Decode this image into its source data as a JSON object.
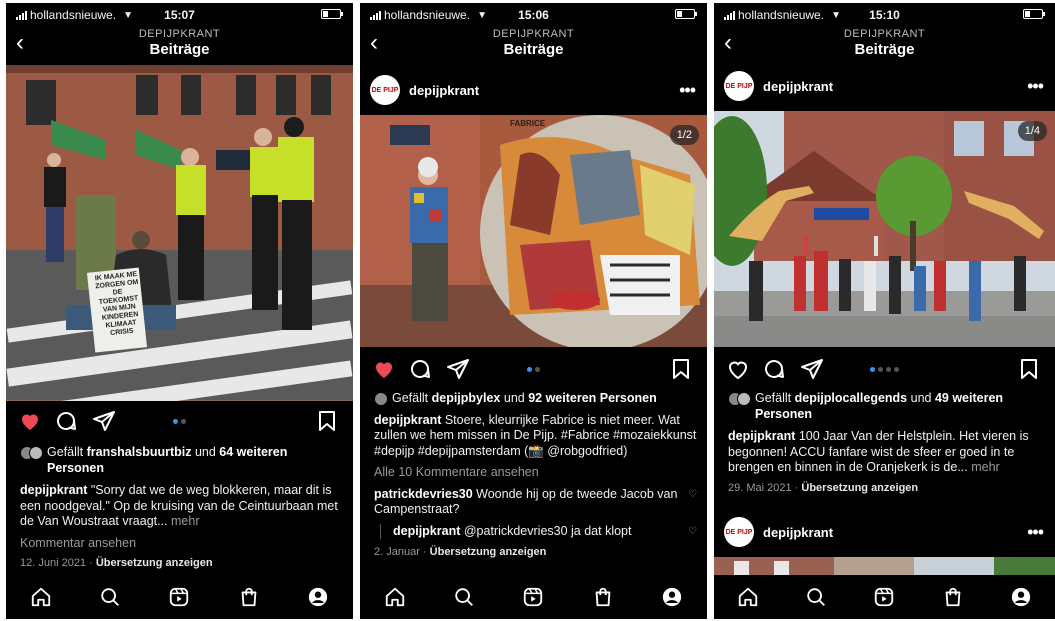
{
  "colors": {
    "background": "#000000",
    "like_red": "#ed4956",
    "dot_blue": "#3897f0",
    "muted": "#9a9a9a"
  },
  "icons": {
    "back": "chevron-left-icon",
    "more": "ellipsis-icon",
    "like": "heart-icon",
    "comment": "comment-bubble-icon",
    "share": "paper-plane-icon",
    "save": "bookmark-icon",
    "home": "home-icon",
    "search": "search-icon",
    "reels": "reels-icon",
    "shop": "shopping-bag-icon",
    "profile": "profile-icon"
  },
  "phones": [
    {
      "status": {
        "carrier": "hollandsnieuwe.",
        "time": "15:07"
      },
      "header": {
        "account": "DEPIJPKRANT",
        "title": "Beiträge"
      },
      "post": {
        "liked": true,
        "likes_prefix": "Gefällt ",
        "likes_user": "franshalsbuurtbiz",
        "likes_mid": " und ",
        "likes_others": "64 weiteren Personen",
        "caption_user": "depijpkrant",
        "caption_text": " \"Sorry dat we de weg blokkeren, maar dit is een noodgeval.\" Op de kruising van de Ceintuurbaan met de Van Woustraat vraagt...",
        "caption_more": " mehr",
        "view_comments": "Kommentar ansehen",
        "date": "12. Juni 2021",
        "sep": " · ",
        "translate": "Übersetzung anzeigen",
        "sign_text": "IK MAAK ME ZORGEN OM DE TOEKOMST VAN MIJN KINDEREN KLIMAAT CRISIS"
      }
    },
    {
      "status": {
        "carrier": "hollandsnieuwe.",
        "time": "15:06"
      },
      "header": {
        "account": "DEPIJPKRANT",
        "title": "Beiträge"
      },
      "post": {
        "username": "depijpkrant",
        "avatar_text": "DE PIJP",
        "counter": "1/2",
        "liked": true,
        "likes_prefix": "Gefällt ",
        "likes_user": "depijpbylex",
        "likes_mid": " und ",
        "likes_others": "92 weiteren Personen",
        "caption_user": "depijpkrant",
        "caption_text": " Stoere, kleurrijke Fabrice is niet meer. Wat zullen we hem missen in De Pijp. #Fabrice #mozaiekkunst #depijp #depijpamsterdam (📸 @robgodfried)",
        "view_all": "Alle 10 Kommentare ansehen",
        "comment1_user": "patrickdevries30",
        "comment1_text": " Woonde hij op de tweede Jacob van Campenstraat?",
        "comment2_user": "depijpkrant",
        "comment2_text": " @patrickdevries30 ja dat klopt",
        "date": "2. Januar",
        "sep": " · ",
        "translate": "Übersetzung anzeigen",
        "mural_label": "FABRICE"
      }
    },
    {
      "status": {
        "carrier": "hollandsnieuwe.",
        "time": "15:10"
      },
      "header": {
        "account": "DEPIJPKRANT",
        "title": "Beiträge"
      },
      "post": {
        "username": "depijpkrant",
        "avatar_text": "DE PIJP",
        "counter": "1/4",
        "liked": false,
        "likes_prefix": "Gefällt ",
        "likes_user": "depijplocallegends",
        "likes_mid": " und ",
        "likes_others": "49 weiteren Personen",
        "caption_user": "depijpkrant",
        "caption_text": " 100 Jaar Van der Helstplein. Het vieren is begonnen! ACCU fanfare wist de sfeer er goed in te brengen en binnen in de Oranjekerk is de...",
        "caption_more": " mehr",
        "date": "29. Mai 2021",
        "sep": " · ",
        "translate": "Übersetzung anzeigen",
        "next_username": "depijpkrant"
      }
    }
  ]
}
